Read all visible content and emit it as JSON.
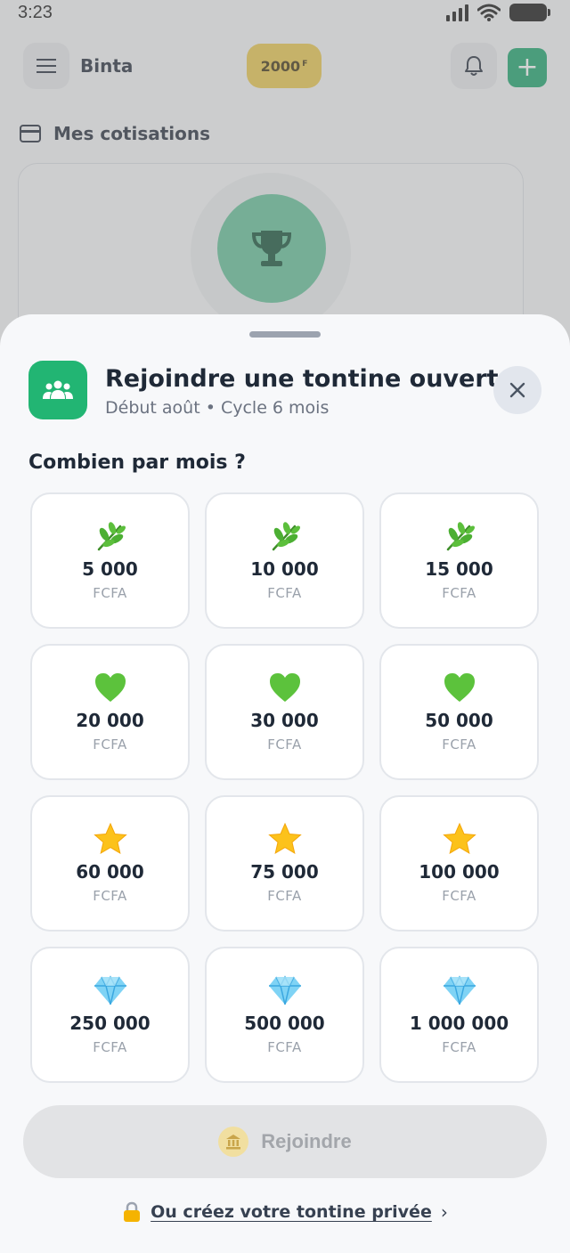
{
  "status_bar": {
    "time": "3:23"
  },
  "header": {
    "user_name": "Binta",
    "coins": "2000",
    "coin_unit": "F"
  },
  "section": {
    "title": "Mes cotisations"
  },
  "sheet": {
    "title": "Rejoindre une tontine ouverte",
    "subtitle": "Début août • Cycle 6 mois",
    "question": "Combien par mois ?",
    "amounts": [
      {
        "value": "5 000",
        "currency": "FCFA",
        "icon": "leaf-icon"
      },
      {
        "value": "10 000",
        "currency": "FCFA",
        "icon": "leaf-icon"
      },
      {
        "value": "15 000",
        "currency": "FCFA",
        "icon": "leaf-icon"
      },
      {
        "value": "20 000",
        "currency": "FCFA",
        "icon": "green-heart-icon"
      },
      {
        "value": "30 000",
        "currency": "FCFA",
        "icon": "green-heart-icon"
      },
      {
        "value": "50 000",
        "currency": "FCFA",
        "icon": "green-heart-icon"
      },
      {
        "value": "60 000",
        "currency": "FCFA",
        "icon": "star-icon"
      },
      {
        "value": "75 000",
        "currency": "FCFA",
        "icon": "star-icon"
      },
      {
        "value": "100 000",
        "currency": "FCFA",
        "icon": "star-icon"
      },
      {
        "value": "250 000",
        "currency": "FCFA",
        "icon": "diamond-icon"
      },
      {
        "value": "500 000",
        "currency": "FCFA",
        "icon": "diamond-icon"
      },
      {
        "value": "1 000 000",
        "currency": "FCFA",
        "icon": "diamond-icon"
      }
    ],
    "join_label": "Rejoindre",
    "private_link": "Ou créez votre tontine privée"
  },
  "colors": {
    "accent": "#22b573",
    "coin": "#e9c649",
    "disabled": "#e2e3e5"
  }
}
